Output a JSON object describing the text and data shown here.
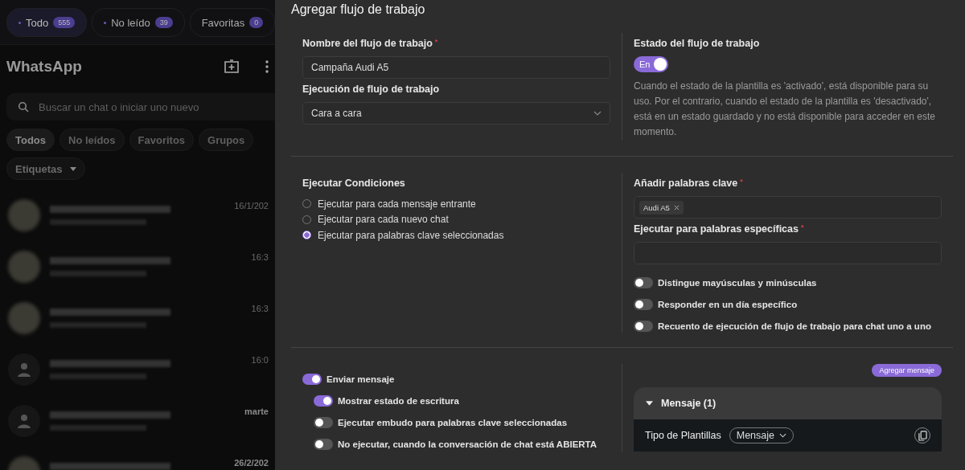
{
  "top_filters": [
    {
      "label": "Todo",
      "count": "555",
      "selected": true,
      "dot": true
    },
    {
      "label": "No leído",
      "count": "39",
      "selected": false,
      "dot": true
    },
    {
      "label": "Favoritas",
      "count": "0",
      "selected": false,
      "dot": false
    }
  ],
  "chat_app": {
    "title": "WhatsApp",
    "search": {
      "placeholder": "Buscar un chat o iniciar uno nuevo"
    },
    "chips": [
      {
        "label": "Todos",
        "selected": true
      },
      {
        "label": "No leídos",
        "selected": false
      },
      {
        "label": "Favoritos",
        "selected": false
      },
      {
        "label": "Grupos",
        "selected": false
      }
    ],
    "labels_dropdown": "Etiquetas",
    "chats": [
      {
        "kind": "image",
        "time": "16/1/202",
        "bold_time": false
      },
      {
        "kind": "image",
        "time": "16:3",
        "bold_time": false
      },
      {
        "kind": "image",
        "time": "16:3",
        "bold_time": false
      },
      {
        "kind": "person",
        "time": "16:0",
        "bold_time": false
      },
      {
        "kind": "person",
        "time": "marte",
        "bold_time": true
      },
      {
        "kind": "image",
        "time": "26/2/202",
        "bold_time": true
      }
    ]
  },
  "dialog": {
    "title": "Agregar flujo de trabajo",
    "name_field": {
      "label": "Nombre del flujo de trabajo",
      "required_mark": "*",
      "value": "Campaña Audi A5"
    },
    "execution_field": {
      "label": "Ejecución de flujo de trabajo",
      "value": "Cara a cara"
    },
    "status": {
      "label": "Estado del flujo de trabajo",
      "on": true,
      "toggle_text": "En",
      "description": "Cuando el estado de la plantilla es 'activado', está disponible para su uso. Por el contrario, cuando el estado de la plantilla es 'desactivado', está en un estado guardado y no está disponible para acceder en este momento."
    },
    "conditions": {
      "label": "Ejecutar Condiciones",
      "options": [
        {
          "label": "Ejecutar para cada mensaje entrante",
          "selected": false
        },
        {
          "label": "Ejecutar para cada nuevo chat",
          "selected": false
        },
        {
          "label": "Ejecutar para palabras clave seleccionadas",
          "selected": true
        }
      ]
    },
    "keywords": {
      "label": "Añadir palabras clave",
      "required_mark": "*",
      "tags": [
        "Audi A5"
      ]
    },
    "specific_words": {
      "label": "Ejecutar para palabras específicas",
      "required_mark": "*"
    },
    "keyword_toggles": [
      {
        "label": "Distingue mayúsculas y minúsculas",
        "on": false
      },
      {
        "label": "Responder en un día específico",
        "on": false
      },
      {
        "label": "Recuento de ejecución de flujo de trabajo para chat uno a uno",
        "on": false
      }
    ],
    "message_toggles": [
      {
        "label": "Enviar mensaje",
        "on": true,
        "children": [
          {
            "label": "Mostrar estado de escritura",
            "on": true
          },
          {
            "label": "Ejecutar embudo para palabras clave seleccionadas",
            "on": false
          },
          {
            "label": "No ejecutar, cuando la conversación de chat está ABIERTA",
            "on": false
          }
        ]
      }
    ],
    "add_message_button": "Agregar mensaje",
    "message_card": {
      "title": "Mensaje (1)",
      "expanded": true,
      "template_label": "Tipo de Plantillas",
      "template_value": "Mensaje"
    }
  }
}
